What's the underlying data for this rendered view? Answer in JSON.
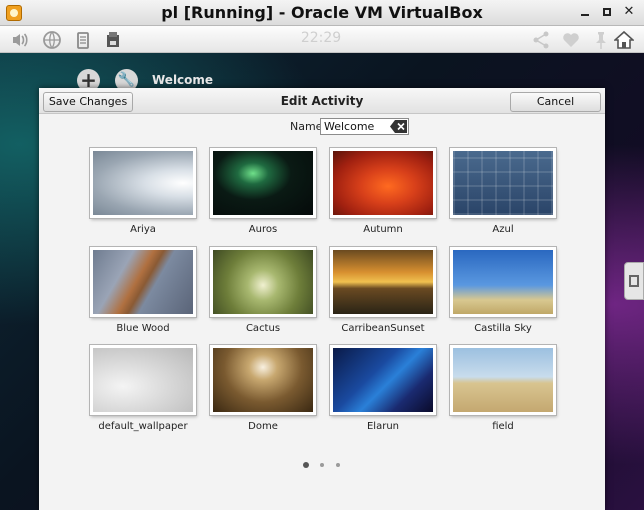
{
  "window": {
    "title": "pl [Running] - Oracle VM VirtualBox",
    "controls": [
      "minimize",
      "maximize",
      "close"
    ]
  },
  "statusbar": {
    "clock": "22:29",
    "left_icons": [
      "volume-icon",
      "network-icon",
      "clipboard-icon",
      "storage-icon"
    ],
    "right_icons": [
      "share-icon",
      "heart-icon",
      "pin-icon",
      "home-icon"
    ]
  },
  "desktop": {
    "activity_label": "Welcome",
    "icons": [
      "add-icon",
      "wrench-icon"
    ]
  },
  "dialog": {
    "title": "Edit Activity",
    "save_label": "Save Changes",
    "cancel_label": "Cancel",
    "name_label": "Name:",
    "name_value": "Welcome"
  },
  "wallpapers": [
    {
      "label": "Ariya"
    },
    {
      "label": "Auros"
    },
    {
      "label": "Autumn"
    },
    {
      "label": "Azul"
    },
    {
      "label": "Blue Wood"
    },
    {
      "label": "Cactus"
    },
    {
      "label": "CarribeanSunset"
    },
    {
      "label": "Castilla Sky"
    },
    {
      "label": "default_wallpaper"
    },
    {
      "label": "Dome"
    },
    {
      "label": "Elarun"
    },
    {
      "label": "field"
    }
  ],
  "pagination": {
    "pages": 3,
    "current": 1
  }
}
